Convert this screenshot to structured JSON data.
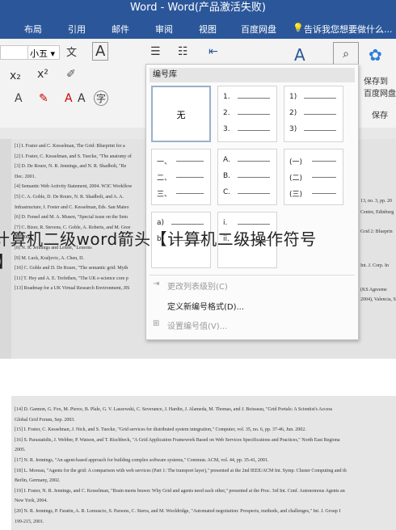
{
  "title": "Word - Word(产品激活失败)",
  "tabs": [
    "布局",
    "引用",
    "邮件",
    "审阅",
    "视图",
    "百度网盘"
  ],
  "tellme": "告诉我您想要做什么...",
  "ribbon": {
    "font_size": "小五",
    "wen": "文",
    "letter_a": "A",
    "save_label_1": "保存到",
    "save_label_2": "百度网盘",
    "save_label_3": "保存",
    "x2": "x₂",
    "xsup": "x²",
    "zi": "字"
  },
  "numbering": {
    "header": "编号库",
    "none_label": "无",
    "cells": [
      {
        "marks": [
          "1.",
          "2.",
          "3."
        ]
      },
      {
        "marks": [
          "1)",
          "2)",
          "3)"
        ]
      },
      {
        "marks": [
          "一、",
          "二、",
          "三、"
        ]
      },
      {
        "marks": [
          "A.",
          "B.",
          "C."
        ]
      },
      {
        "marks": [
          "(一)",
          "(二)",
          "(三)"
        ]
      },
      {
        "marks": [
          "a)",
          "b)",
          ""
        ]
      },
      {
        "marks": [
          "i.",
          "ii.",
          ""
        ]
      }
    ],
    "menu": {
      "change_level": "更改列表级别(C)",
      "define_new": "定义新编号格式(D)...",
      "set_value": "设置编号值(V)..."
    }
  },
  "overlay": {
    "line1": "计算机二级word箭头【计算机二级操作符号",
    "line2": "】"
  },
  "doc_top": [
    "[1] I. Foster and C. Kesselman, The Grid: Blueprint for a",
    "[2] I. Foster, C. Kesselman, and S. Tuecke, \"The anatomy of",
    "[3] D. De Roure, N. R. Jennings, and N. R. Shadbolt, \"Re",
    "Dec. 2001.",
    "[4] Semantic Web Activity Statement, 2004. W3C Workflow",
    "[5] C. A. Goble, D. De Roure, N. R. Shadbolt, and A. A.",
    "Infrastructure, I. Foster and C. Kesselman, Eds. San Mateo",
    "[6] D. Fensel and M. A. Musen, \"Special issue on the Sem",
    "[7] C. Bizer, R. Stevens, C. Goble, A. Roberts, and M. Gree",
    "24, 2002.",
    "[8] N. R. Jennings and Lesser, \"Lessons",
    "[9] M. Luck, Kraljevic, A. Chen, D.",
    "[10] C. Goble and D. De Roure, \"The semantic grid: Myth",
    "[11] T. Hey and A. E. Trefethen, \"The UK e-science core p",
    "[13] Roadmap for a UK Virtual Research Environment, JIS"
  ],
  "doc_top_right": [
    "13, no. 3, pp. 20",
    "Centre, Edinburg",
    "Grid 2: Blueprin",
    "Int. J. Corp. In",
    "(KS Agreeme",
    "2004), Valencia, Sp"
  ],
  "doc_bottom": [
    "[14] D. Gannon, G. Fox, M. Pierce, B. Plale, G. V. Laszewski, C. Severance, J. Hardin, J. Alameda, M. Thomas, and J. Boisseau, \"Grid Portals: A Scientist's Access",
    "Global Grid Forum, Sep. 2003.",
    "[15] I. Foster, C. Kesselman, J. Nick, and S. Tuecke, \"Grid services for distributed system integration,\" Computer, vol. 35, no. 6, pp. 37-46, Jun. 2002.",
    "[16] S. Parastatidis, J. Webber, P. Watson, and T. Rischbeck, \"A Grid Application Framework Based on Web Services Specifications and Practices,\" North East Regiona",
    "2005.",
    "[17] N. R. Jennings, \"An agent-based approach for building complex software systems,\" Commun. ACM, vol. 44, pp. 35-41, 2001.",
    "[18] L. Moreau, \"Agents for the grid: A comparison with web services (Part 1: The transport layer),\" presented at the 2nd IEEE/ACM Int. Symp. Cluster Computing and th",
    "Berlin, Germany, 2002.",
    "[19] I. Foster, N. R. Jennings, and C. Kesselman, \"Brain meets brawn: Why Grid and agents need each other,\" presented at the Proc. 3rd Int. Conf. Autonomous Agents an",
    "New York, 2004.",
    "[20] N. R. Jennings, P. Faratin, A. R. Lomuscio, S. Parsons, C. Sierra, and M. Wooldridge, \"Automated negotiation: Prospects, methods, and challenges,\" Int. J. Group I",
    "199-215, 2001."
  ]
}
